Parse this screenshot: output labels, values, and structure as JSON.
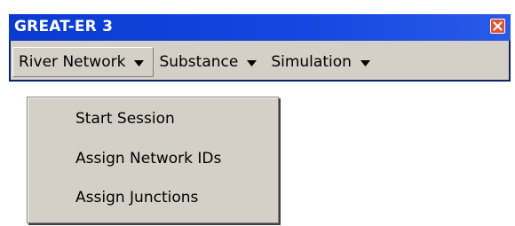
{
  "window": {
    "title": "GREAT-ER 3",
    "close_icon": "close-icon"
  },
  "menubar": {
    "items": [
      {
        "label": "River Network",
        "icon": "triangle-down-icon",
        "open": true
      },
      {
        "label": "Substance",
        "icon": "triangle-down-icon",
        "open": false
      },
      {
        "label": "Simulation",
        "icon": "triangle-down-icon",
        "open": false
      }
    ]
  },
  "dropdown": {
    "items": [
      {
        "label": "Start Session"
      },
      {
        "label": "Assign Network IDs"
      },
      {
        "label": "Assign Junctions"
      }
    ]
  },
  "colors": {
    "titlebar": "#0a3ad0",
    "face": "#d4d0c8",
    "close": "#e4502c"
  }
}
